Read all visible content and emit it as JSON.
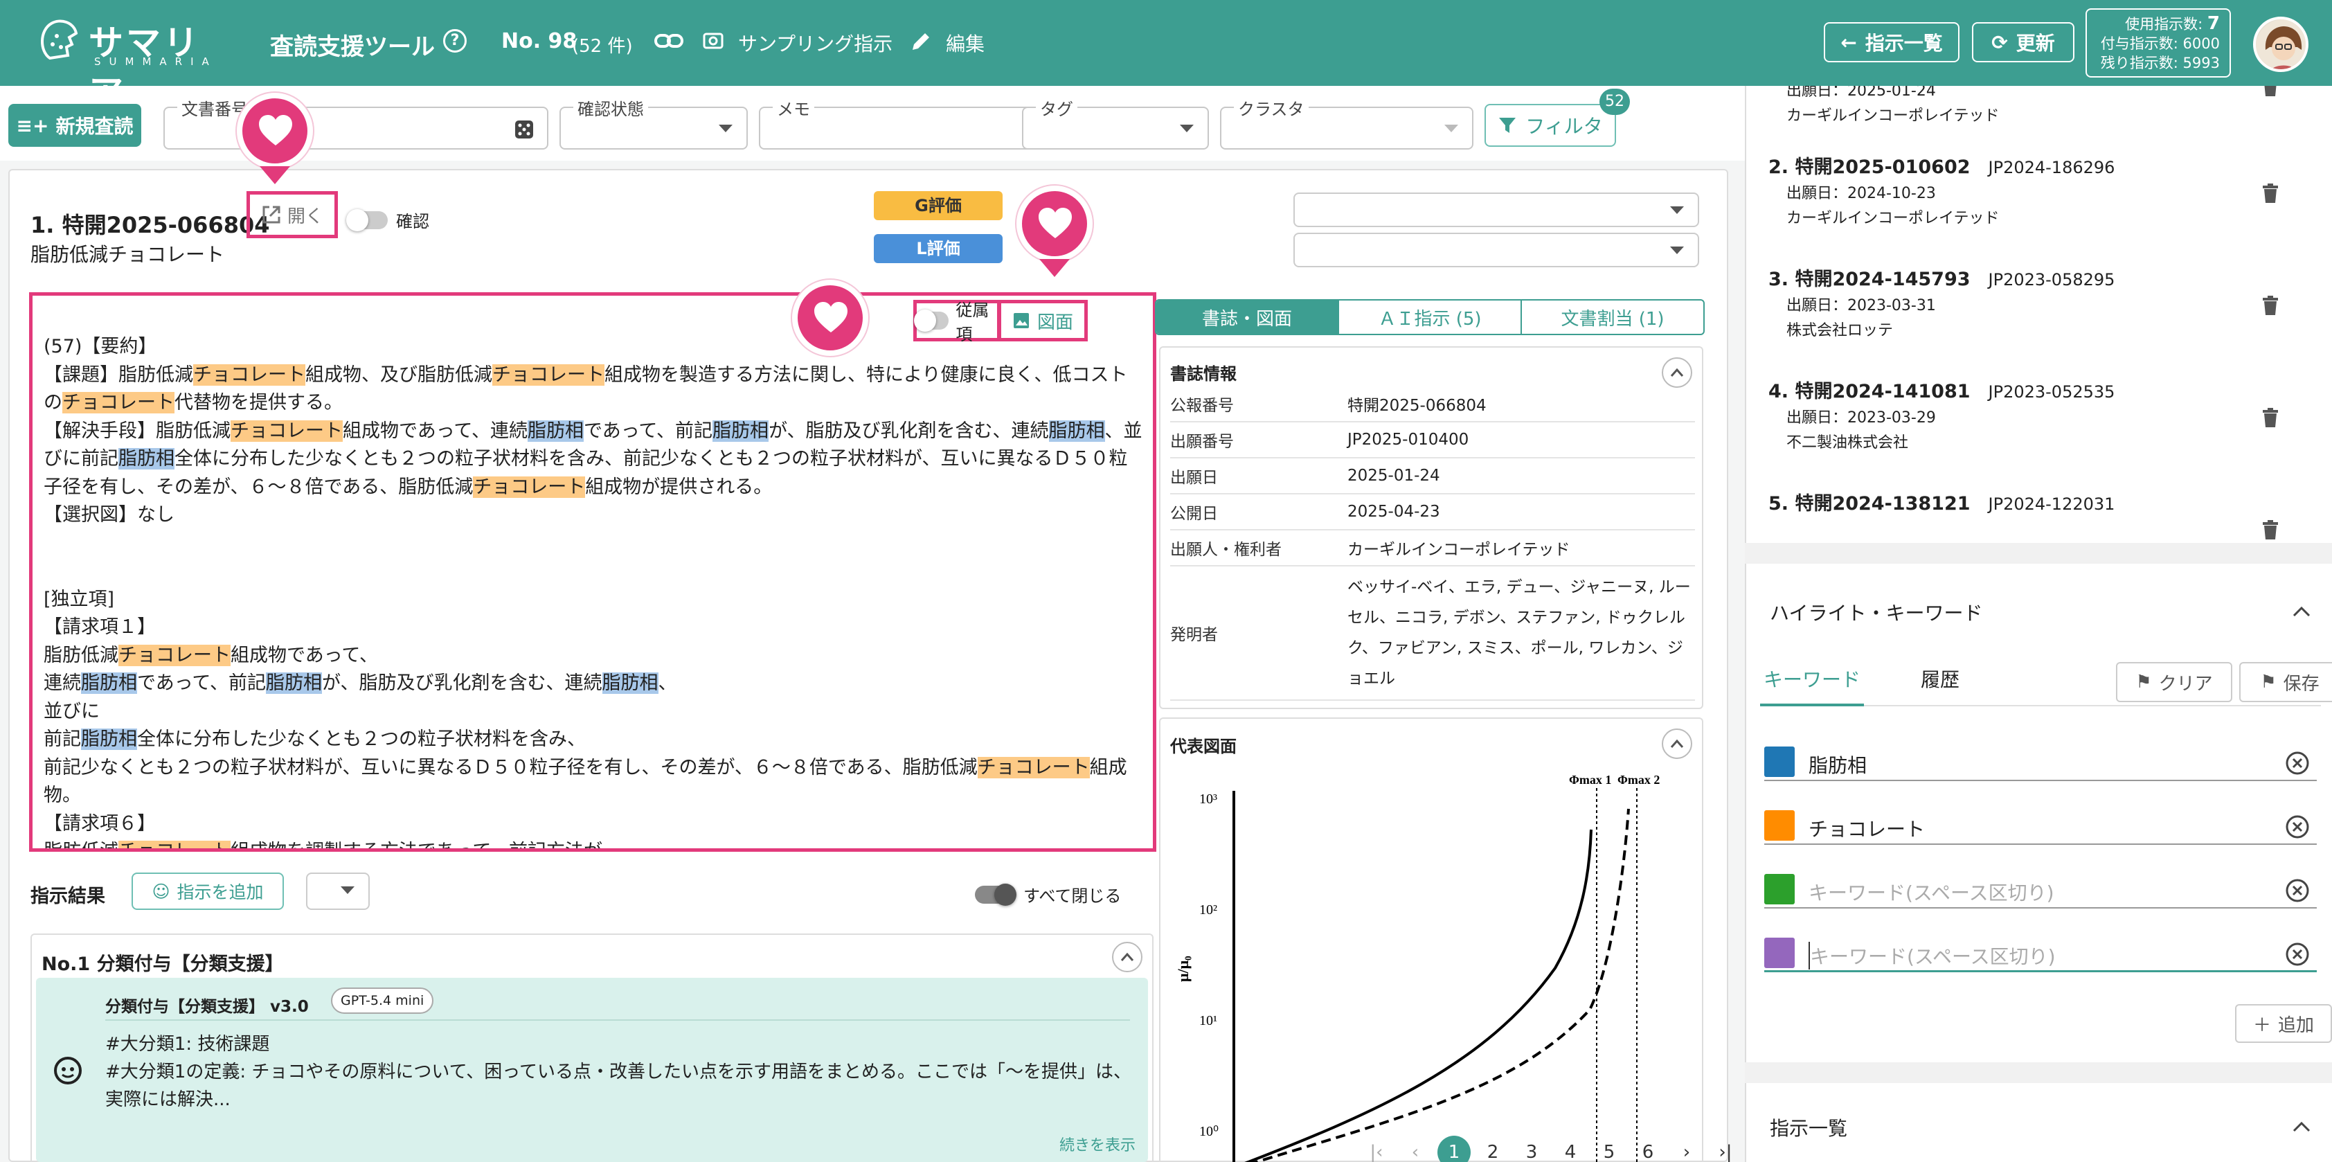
{
  "header": {
    "logo_jp": "サマリア",
    "logo_en": "SUMMARIA",
    "app_title": "査読支援ツール",
    "record_no": "No. 98",
    "record_count": "(52 件)",
    "sampling_label": "サンプリング指示",
    "edit_label": "編集",
    "back_label": "指示一覧",
    "refresh_label": "更新",
    "usage": {
      "used_label": "使用指示数:",
      "used": "7",
      "granted_label": "付与指示数:",
      "granted": "6000",
      "remaining_label": "残り指示数:",
      "remaining": "5993"
    }
  },
  "toolbar": {
    "new_label": "新規査読",
    "doc_no_label": "文書番号",
    "status_label": "確認状態",
    "memo_label": "メモ",
    "tag_label": "タグ",
    "cluster_label": "クラスタ",
    "filter_label": "フィルタ",
    "filter_count": "52"
  },
  "patent": {
    "title": "1. 特開2025-066804",
    "subtitle": "脂肪低減チョコレート",
    "open_label": "開く",
    "confirm_label": "確認",
    "g_label": "G評価",
    "l_label": "L評価",
    "dependent_label": "従属項",
    "figure_label": "図面"
  },
  "abstract_segments": [
    {
      "t": "(57)【要約】\n【課題】脂肪低減",
      "h": ""
    },
    {
      "t": "チョコレート",
      "h": "o"
    },
    {
      "t": "組成物、及び脂肪低減",
      "h": ""
    },
    {
      "t": "チョコレート",
      "h": "o"
    },
    {
      "t": "組成物を製造する方法に関し、特により健康に良く、低コストの",
      "h": ""
    },
    {
      "t": "チョコレート",
      "h": "o"
    },
    {
      "t": "代替物を提供する。\n【解決手段】脂肪低減",
      "h": ""
    },
    {
      "t": "チョコレート",
      "h": "o"
    },
    {
      "t": "組成物であって、連続",
      "h": ""
    },
    {
      "t": "脂肪相",
      "h": "b"
    },
    {
      "t": "であって、前記",
      "h": ""
    },
    {
      "t": "脂肪相",
      "h": "b"
    },
    {
      "t": "が、脂肪及び乳化剤を含む、連続",
      "h": ""
    },
    {
      "t": "脂肪相",
      "h": "b"
    },
    {
      "t": "、並びに前記",
      "h": ""
    },
    {
      "t": "脂肪相",
      "h": "b"
    },
    {
      "t": "全体に分布した少なくとも２つの粒子状材料を含み、前記少なくとも２つの粒子状材料が、互いに異なるＤ５０粒子径を有し、その差が、６〜８倍である、脂肪低減",
      "h": ""
    },
    {
      "t": "チョコレート",
      "h": "o"
    },
    {
      "t": "組成物が提供される。\n【選択図】なし\n\n\n[独立項]\n【請求項１】\n脂肪低減",
      "h": ""
    },
    {
      "t": "チョコレート",
      "h": "o"
    },
    {
      "t": "組成物であって、\n連続",
      "h": ""
    },
    {
      "t": "脂肪相",
      "h": "b"
    },
    {
      "t": "であって、前記",
      "h": ""
    },
    {
      "t": "脂肪相",
      "h": "b"
    },
    {
      "t": "が、脂肪及び乳化剤を含む、連続",
      "h": ""
    },
    {
      "t": "脂肪相",
      "h": "b"
    },
    {
      "t": "、\n並びに\n前記",
      "h": ""
    },
    {
      "t": "脂肪相",
      "h": "b"
    },
    {
      "t": "全体に分布した少なくとも２つの粒子状材料を含み、\n前記少なくとも２つの粒子状材料が、互いに異なるＤ５０粒子径を有し、その差が、６〜８倍である、脂肪低減",
      "h": ""
    },
    {
      "t": "チョコレート",
      "h": "o"
    },
    {
      "t": "組成物。\n【請求項６】\n脂肪低減",
      "h": ""
    },
    {
      "t": "チョコレート",
      "h": "o"
    },
    {
      "t": "組成物を調製する方法であって、前記方法が、",
      "h": ""
    }
  ],
  "doc_tabs": [
    "書誌・図面",
    "ＡＩ指示 (5)",
    "文書割当 (1)"
  ],
  "bib": {
    "heading": "書誌情報",
    "rows": [
      {
        "k": "公報番号",
        "v": "特開2025-066804"
      },
      {
        "k": "出願番号",
        "v": "JP2025-010400"
      },
      {
        "k": "出願日",
        "v": "2025-01-24"
      },
      {
        "k": "公開日",
        "v": "2025-04-23"
      },
      {
        "k": "出願人・権利者",
        "v": "カーギルインコーポレイテッド"
      },
      {
        "k": "発明者",
        "v": "ベッサイ-ベイ、エラ, デュー、ジャニーヌ, ルーセル、ニコラ, デボン、ステファン, ドゥクレルク、ファビアン, スミス、ポール, ワレカン、ジョエル"
      }
    ]
  },
  "drawing": {
    "heading": "代表図面",
    "ylabel": "μ/μ₀",
    "yticks": [
      "10³",
      "10²",
      "10¹",
      "10⁰"
    ],
    "phi1": "Φmax 1",
    "phi2": "Φmax 2"
  },
  "results": {
    "heading": "指示結果",
    "add_label": "指示を追加",
    "close_all_label": "すべて閉じる",
    "item_title": "No.1 分類付与【分類支援】",
    "item_name": "分類付与【分類支援】 v3.0",
    "model": "GPT-5.4 mini",
    "body": "#大分類1: 技術課題\n#大分類1の定義: チョコやその原料について、困っている点・改善したい点を示す用語をまとめる。ここでは「〜を提供」は、実際には解決...",
    "more_label": "続きを表示"
  },
  "pager": {
    "pages": [
      "1",
      "2",
      "3",
      "4",
      "5",
      "6"
    ],
    "current": "1"
  },
  "doc_list": {
    "top_partial_date": "出願日：2025-01-24",
    "top_partial_applicant": "カーギルインコーポレイテッド",
    "items": [
      {
        "title": "2. 特開2025-010602",
        "jp": "JP2024-186296",
        "date": "出願日：2024-10-23",
        "applicant": "カーギルインコーポレイテッド"
      },
      {
        "title": "3. 特開2024-145793",
        "jp": "JP2023-058295",
        "date": "出願日：2023-03-31",
        "applicant": "株式会社ロッテ"
      },
      {
        "title": "4. 特開2024-141081",
        "jp": "JP2023-052535",
        "date": "出願日：2023-03-29",
        "applicant": "不二製油株式会社"
      },
      {
        "title": "5. 特開2024-138121",
        "jp": "JP2024-122031",
        "date": "",
        "applicant": ""
      }
    ]
  },
  "keywords": {
    "heading": "ハイライト・キーワード",
    "tab_keyword": "キーワード",
    "tab_history": "履歴",
    "clear_label": "クリア",
    "save_label": "保存",
    "items": [
      {
        "value": "脂肪相",
        "color": "#1f77b4"
      },
      {
        "value": "チョコレート",
        "color": "#ff8c00"
      },
      {
        "value": "",
        "color": "#2ca02c"
      },
      {
        "value": "",
        "color": "#9467bd"
      }
    ],
    "placeholder": "キーワード(スペース区切り)",
    "add_label": "追加"
  },
  "instruction_list": {
    "heading": "指示一覧"
  },
  "colors": {
    "accent": "#3d9e91",
    "callout": "#e23a7b",
    "orange_hl": "#fdca86",
    "blue_hl": "#a8c8ea"
  }
}
